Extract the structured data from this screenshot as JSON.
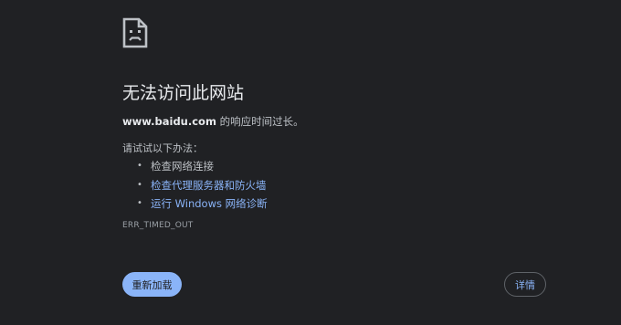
{
  "error": {
    "title": "无法访问此网站",
    "domain": "www.baidu.com",
    "message": " 的响应时间过长。",
    "suggestions_heading": "请试试以下办法：",
    "suggestions": [
      {
        "label": "检查网络连接",
        "is_link": false
      },
      {
        "label": "检查代理服务器和防火墙",
        "is_link": true
      },
      {
        "label": "运行 Windows 网络诊断",
        "is_link": true
      }
    ],
    "code": "ERR_TIMED_OUT"
  },
  "buttons": {
    "reload_label": "重新加载",
    "details_label": "详情"
  },
  "icons": {
    "sad_page": "sad-page-icon",
    "bullet": "•"
  },
  "colors": {
    "background": "#202124",
    "title": "#e8eaed",
    "text": "#bdc1c6",
    "link": "#8ab4f8",
    "primary_button": "#8ab4f8",
    "border": "#5f6368"
  }
}
